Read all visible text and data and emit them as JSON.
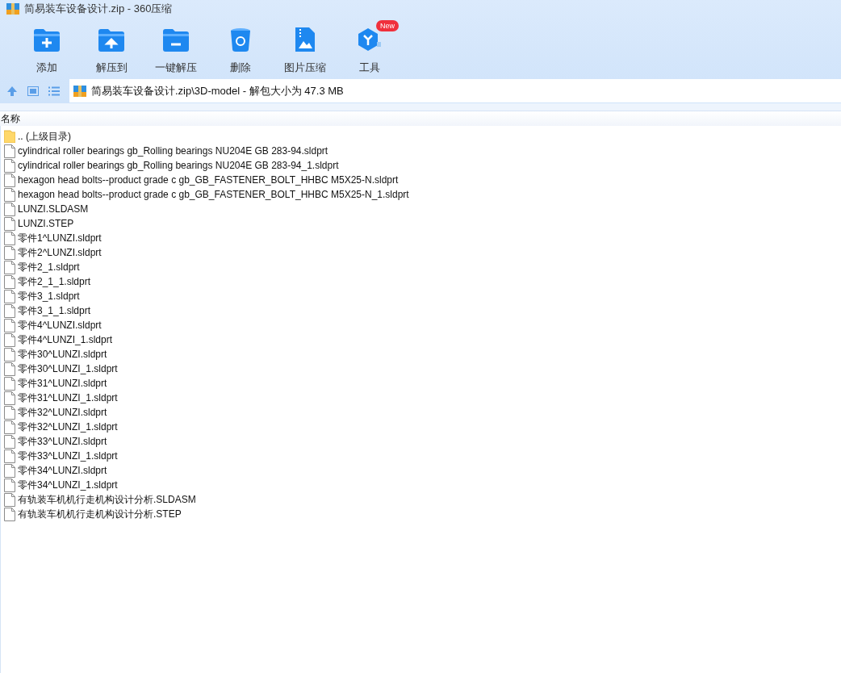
{
  "window": {
    "title": "简易装车设备设计.zip - 360压缩"
  },
  "toolbar": [
    {
      "label": "添加",
      "kind": "add"
    },
    {
      "label": "解压到",
      "kind": "extract"
    },
    {
      "label": "一键解压",
      "kind": "oneclick"
    },
    {
      "label": "删除",
      "kind": "delete"
    },
    {
      "label": "图片压缩",
      "kind": "image"
    },
    {
      "label": "工具",
      "kind": "tools",
      "badge": "New"
    }
  ],
  "address": {
    "path": "简易装车设备设计.zip\\3D-model - 解包大小为 47.3 MB"
  },
  "table": {
    "columns": [
      "名称"
    ],
    "rows": [
      {
        "name": ".. (上级目录)",
        "kind": "folder"
      },
      {
        "name": "cylindrical roller bearings gb_Rolling bearings NU204E GB 283-94.sldprt",
        "kind": "file"
      },
      {
        "name": "cylindrical roller bearings gb_Rolling bearings NU204E GB 283-94_1.sldprt",
        "kind": "file"
      },
      {
        "name": "hexagon head bolts--product grade c gb_GB_FASTENER_BOLT_HHBC M5X25-N.sldprt",
        "kind": "file"
      },
      {
        "name": "hexagon head bolts--product grade c gb_GB_FASTENER_BOLT_HHBC M5X25-N_1.sldprt",
        "kind": "file"
      },
      {
        "name": "LUNZI.SLDASM",
        "kind": "file"
      },
      {
        "name": "LUNZI.STEP",
        "kind": "file"
      },
      {
        "name": "零件1^LUNZI.sldprt",
        "kind": "file"
      },
      {
        "name": "零件2^LUNZI.sldprt",
        "kind": "file"
      },
      {
        "name": "零件2_1.sldprt",
        "kind": "file"
      },
      {
        "name": "零件2_1_1.sldprt",
        "kind": "file"
      },
      {
        "name": "零件3_1.sldprt",
        "kind": "file"
      },
      {
        "name": "零件3_1_1.sldprt",
        "kind": "file"
      },
      {
        "name": "零件4^LUNZI.sldprt",
        "kind": "file"
      },
      {
        "name": "零件4^LUNZI_1.sldprt",
        "kind": "file"
      },
      {
        "name": "零件30^LUNZI.sldprt",
        "kind": "file"
      },
      {
        "name": "零件30^LUNZI_1.sldprt",
        "kind": "file"
      },
      {
        "name": "零件31^LUNZI.sldprt",
        "kind": "file"
      },
      {
        "name": "零件31^LUNZI_1.sldprt",
        "kind": "file"
      },
      {
        "name": "零件32^LUNZI.sldprt",
        "kind": "file"
      },
      {
        "name": "零件32^LUNZI_1.sldprt",
        "kind": "file"
      },
      {
        "name": "零件33^LUNZI.sldprt",
        "kind": "file"
      },
      {
        "name": "零件33^LUNZI_1.sldprt",
        "kind": "file"
      },
      {
        "name": "零件34^LUNZI.sldprt",
        "kind": "file"
      },
      {
        "name": "零件34^LUNZI_1.sldprt",
        "kind": "file"
      },
      {
        "name": "有轨装车机机行走机构设计分析.SLDASM",
        "kind": "file"
      },
      {
        "name": "有轨装车机机行走机构设计分析.STEP",
        "kind": "file"
      }
    ]
  }
}
